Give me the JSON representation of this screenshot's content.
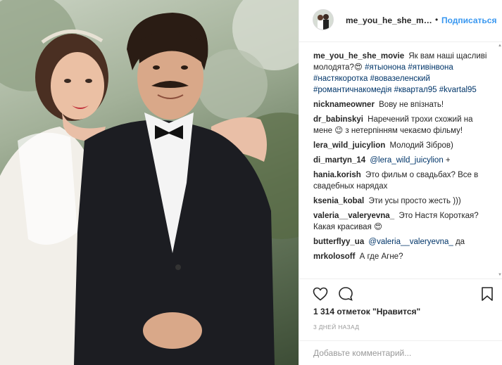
{
  "post": {
    "username": "me_you_he_she_movie",
    "username_short": "me_you_he_she_mo...",
    "separator": "•",
    "follow_label": "Подписаться"
  },
  "caption": {
    "username": "me_you_he_she_movie",
    "text": "Як вам наші щасливі молодята?😍",
    "tags": [
      "#ятыонона",
      "#ятивінвона",
      "#настякоротка",
      "#вовазеленский",
      "#романтичнакомедія",
      "#квартал95",
      "#kvartal95"
    ]
  },
  "comments": [
    {
      "user": "nicknameowner",
      "text": "Вову не впізнать!"
    },
    {
      "user": "dr_babinskyi",
      "text": "Наречений трохи схожий на мене 😉 з нетерпінням чекаємо фільму!"
    },
    {
      "user": "lera_wild_juicylion",
      "text": "Молодий Зібров)"
    },
    {
      "user": "di_martyn_14",
      "mention": "@lera_wild_juicylion",
      "text": " +"
    },
    {
      "user": "hania.korish",
      "text": "Это фильм о свадьбах? Все в свадебных нарядах"
    },
    {
      "user": "ksenia_kobal",
      "text": "Эти усы просто жесть )))"
    },
    {
      "user": "valeria__valeryevna_",
      "text": "Это Настя Короткая? Какая красивая 😍"
    },
    {
      "user": "butterflyy_ua",
      "mention": "@valeria__valeryevna_",
      "text": " да"
    },
    {
      "user": "mrkolosoff",
      "text": "А где Агне?"
    }
  ],
  "likes_text": "1 314 отметок \"Нравится\"",
  "time_text": "3 ДНЕЙ НАЗАД",
  "add_comment": {
    "placeholder": "Добавьте комментарий..."
  },
  "icons": {
    "like": "heart-outline-icon",
    "comment": "speech-bubble-icon",
    "save": "bookmark-icon",
    "scroll_up": "scroll-up-arrow-icon",
    "scroll_down": "scroll-down-arrow-icon"
  },
  "colors": {
    "link": "#3897f0",
    "tag": "#003569",
    "muted": "#999999",
    "border": "#efefef"
  }
}
